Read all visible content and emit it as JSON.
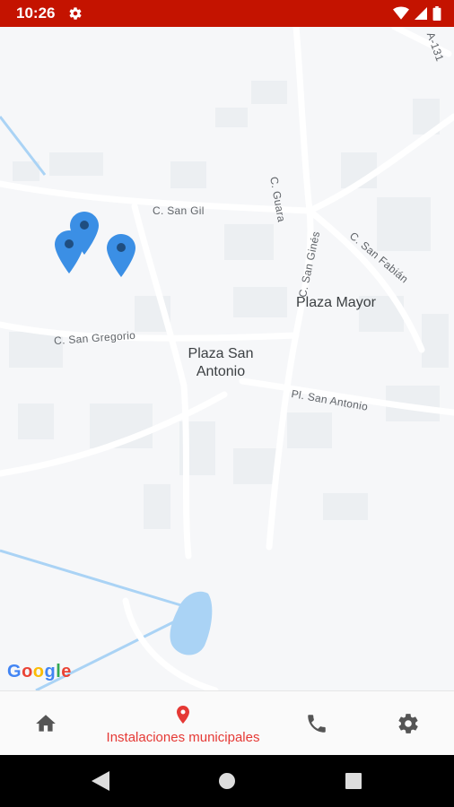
{
  "status_bar": {
    "time": "10:26",
    "icons": [
      "settings-icon",
      "wifi-icon",
      "signal-icon",
      "battery-icon"
    ],
    "background": "#c41300"
  },
  "map": {
    "street_labels": {
      "san_gil": "C. San Gil",
      "san_gregorio": "C. San Gregorio",
      "guara": "C. Guara",
      "san_gines": "C. San Ginés",
      "san_fabian": "C. San Fabián",
      "pl_san_antonio": "Pl. San Antonio",
      "a131": "A-131"
    },
    "places": {
      "plaza_mayor": "Plaza Mayor",
      "plaza_san_antonio_line1": "Plaza San",
      "plaza_san_antonio_line2": "Antonio"
    },
    "markers_count": 3,
    "marker_color": "#3b8fe5",
    "attribution": "Google"
  },
  "bottom_nav": {
    "active_color": "#e53935",
    "items": [
      {
        "icon": "home-icon",
        "label": ""
      },
      {
        "icon": "location-pin-icon",
        "label": "Instalaciones municipales"
      },
      {
        "icon": "phone-icon",
        "label": ""
      },
      {
        "icon": "settings-icon",
        "label": ""
      }
    ]
  },
  "system_nav": {
    "buttons": [
      "back-button",
      "home-button",
      "recents-button"
    ]
  }
}
